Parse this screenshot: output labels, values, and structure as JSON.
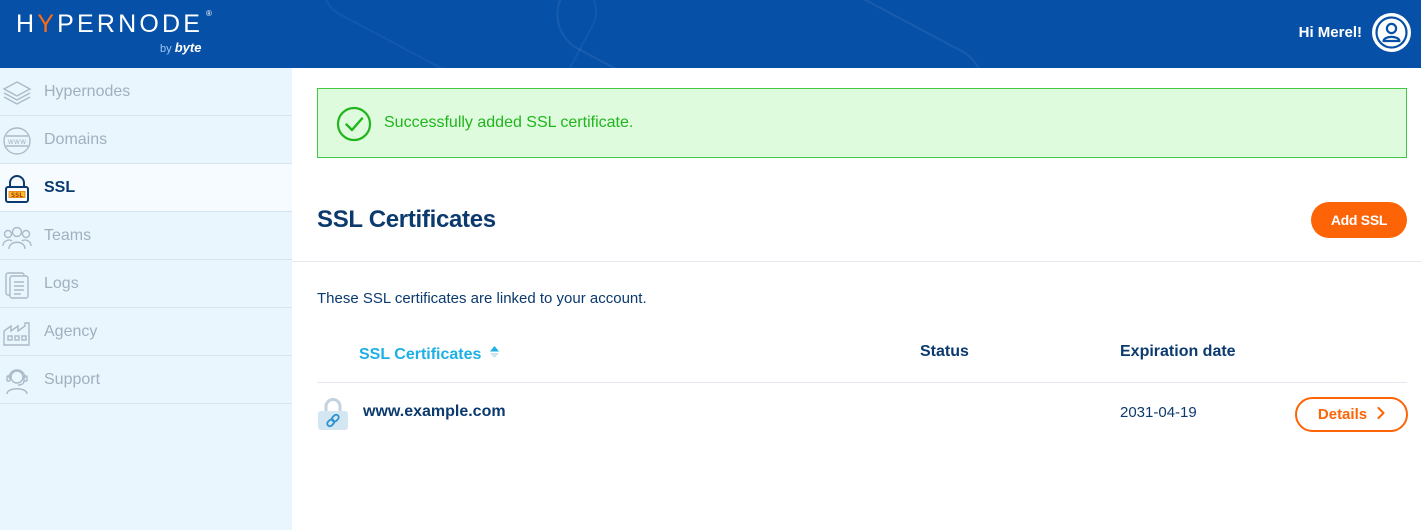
{
  "header": {
    "logo_text_before": "H",
    "logo_text_y": "Y",
    "logo_text_after": "PERNODE",
    "logo_registered": "®",
    "logo_by": "by",
    "logo_byte": "byte",
    "greeting": "Hi Merel!",
    "avatar_icon": "user-circle-icon"
  },
  "sidebar": {
    "items": [
      {
        "label": "Hypernodes",
        "icon": "layers-icon",
        "active": false
      },
      {
        "label": "Domains",
        "icon": "www-globe-icon",
        "active": false
      },
      {
        "label": "SSL",
        "icon": "ssl-lock-icon",
        "active": true
      },
      {
        "label": "Teams",
        "icon": "team-icon",
        "active": false
      },
      {
        "label": "Logs",
        "icon": "logs-icon",
        "active": false
      },
      {
        "label": "Agency",
        "icon": "agency-icon",
        "active": false
      },
      {
        "label": "Support",
        "icon": "support-icon",
        "active": false
      }
    ]
  },
  "alert": {
    "message": "Successfully added SSL certificate.",
    "icon": "check-circle-icon"
  },
  "page": {
    "title": "SSL Certificates",
    "add_button": "Add SSL",
    "description": "These SSL certificates are linked to your account."
  },
  "table": {
    "columns": [
      {
        "label": "SSL Certificates",
        "sortable": true,
        "sort": "ascending"
      },
      {
        "label": "Status"
      },
      {
        "label": "Expiration date"
      }
    ],
    "rows": [
      {
        "domain": "www.example.com",
        "status": "",
        "expiration": "2031-04-19",
        "action": "Details"
      }
    ]
  },
  "colors": {
    "header_bg": "#0750a8",
    "accent_orange": "#fc6407",
    "sidebar_bg": "#eaf6fd",
    "success_green": "#20b51d",
    "sort_blue": "#1cb0e4",
    "text_navy": "#0b3a6e"
  }
}
